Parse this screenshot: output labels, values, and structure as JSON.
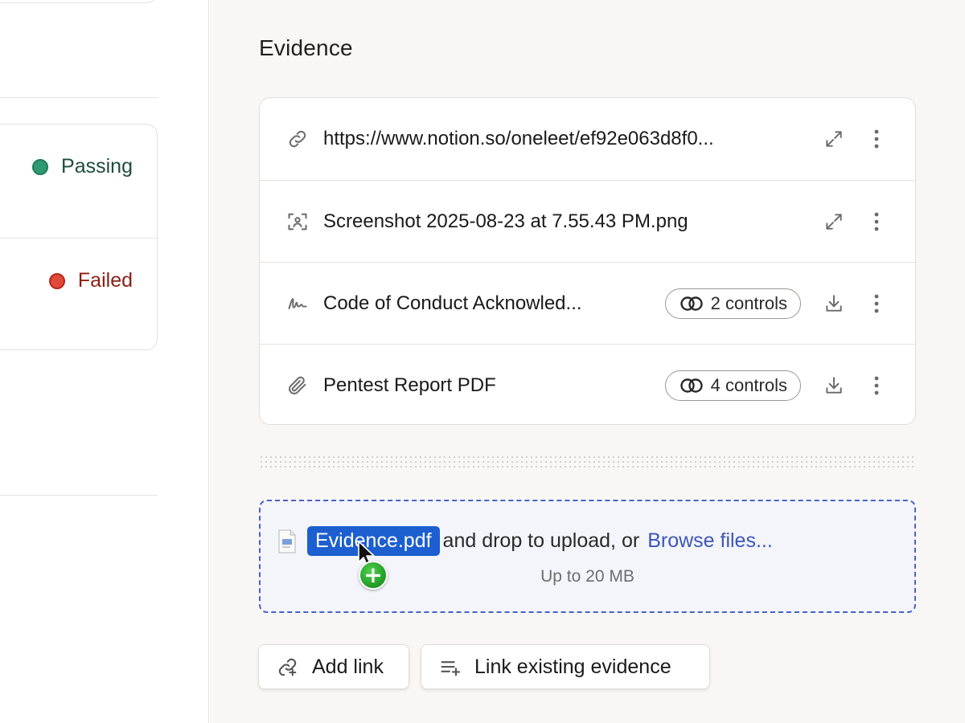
{
  "left_pane": {
    "statuses": [
      {
        "label": "Passing",
        "state": "pass",
        "color": "#2f9a72"
      },
      {
        "label": "Failed",
        "state": "fail",
        "color": "#e04a3a"
      }
    ]
  },
  "evidence": {
    "title": "Evidence",
    "items": [
      {
        "icon": "link-icon",
        "text": "https://www.notion.so/oneleet/ef92e063d8f0...",
        "action_icon": "expand-icon",
        "controls": null
      },
      {
        "icon": "screenshot-icon",
        "text": "Screenshot 2025-08-23 at 7.55.43 PM.png",
        "action_icon": "expand-icon",
        "controls": null
      },
      {
        "icon": "signature-icon",
        "text": "Code of Conduct Acknowled...",
        "action_icon": "download-icon",
        "controls": "2 controls"
      },
      {
        "icon": "paperclip-icon",
        "text": "Pentest Report PDF",
        "action_icon": "download-icon",
        "controls": "4 controls"
      }
    ]
  },
  "dropzone": {
    "dragged_file": "Evidence.pdf",
    "text": "and drop to upload, or",
    "browse_label": "Browse files...",
    "limit": "Up to 20 MB",
    "accent": "#4a63c4"
  },
  "actions": {
    "add_link": "Add link",
    "link_existing": "Link existing evidence"
  }
}
